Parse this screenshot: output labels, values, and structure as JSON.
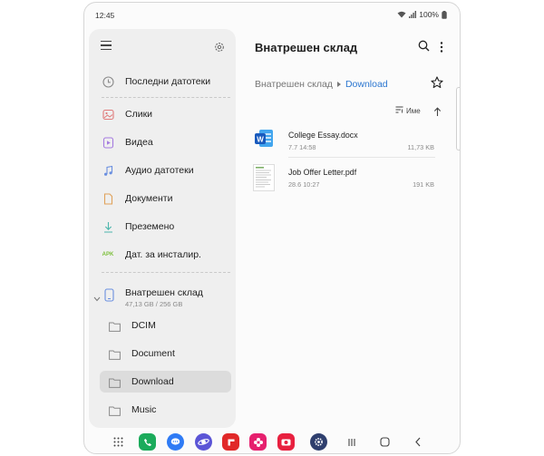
{
  "status_bar": {
    "time": "12:45",
    "battery": "100%",
    "icons": [
      "wifi-icon",
      "signal-icon",
      "battery-icon"
    ]
  },
  "sidebar": {
    "menu_icon": "hamburger-icon",
    "settings_icon": "gear-icon",
    "items": [
      {
        "label": "Последни датотеки",
        "icon": "clock-icon"
      },
      {
        "label": "Слики",
        "icon": "image-icon"
      },
      {
        "label": "Видеа",
        "icon": "video-icon"
      },
      {
        "label": "Аудио датотеки",
        "icon": "music-icon"
      },
      {
        "label": "Документи",
        "icon": "document-icon"
      },
      {
        "label": "Преземено",
        "icon": "download-icon"
      },
      {
        "label": "Дат. за инсталир.",
        "icon": "apk-icon",
        "icon_text": "APK"
      }
    ],
    "storage": {
      "label": "Внатрешен склад",
      "capacity": "47,13 GB / 256 GB"
    },
    "folders": [
      {
        "label": "DCIM",
        "selected": false
      },
      {
        "label": "Document",
        "selected": false
      },
      {
        "label": "Download",
        "selected": true
      },
      {
        "label": "Music",
        "selected": false
      }
    ]
  },
  "main": {
    "title": "Внатрешен склад",
    "breadcrumb": [
      "Внатрешен склад",
      "Download"
    ],
    "sort_label": "Име",
    "files": [
      {
        "name": "College Essay.docx",
        "date": "7.7 14:58",
        "size": "11,73 KB",
        "icon": "word-doc-icon"
      },
      {
        "name": "Job Offer Letter.pdf",
        "date": "28.6 10:27",
        "size": "191 KB",
        "icon": "pdf-thumbnail"
      }
    ]
  },
  "colors": {
    "accent": "#2b76d0",
    "sidebar_bg": "#efefef",
    "selected_bg": "#dcdcdc"
  },
  "taskbar": {
    "apps": [
      "apps-grid-icon",
      "phone-app-icon",
      "messages-app-icon",
      "internet-app-icon",
      "flipboard-app-icon",
      "flower-app-icon",
      "camera-app-icon",
      "settings-app-icon"
    ],
    "nav": [
      "recents-icon",
      "home-icon",
      "back-icon"
    ]
  }
}
